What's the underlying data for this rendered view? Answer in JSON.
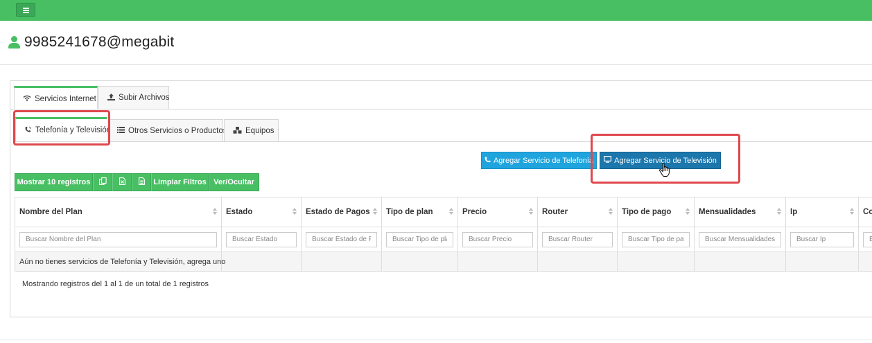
{
  "topbar": {
    "menu_icon": "hamburger-icon",
    "color": "#48bf63"
  },
  "user": {
    "icon": "user-icon",
    "name": "9985241678@megabit"
  },
  "tabs_main": [
    {
      "label": "Servicios Internet",
      "icon": "wifi-icon",
      "active": true
    },
    {
      "label": "Subir Archivos",
      "icon": "upload-icon",
      "active": false
    }
  ],
  "tabs_sub": [
    {
      "label": "Telefonía y Televisión",
      "icon": "phone-icon",
      "active": true
    },
    {
      "label": "Otros Servicios o Productos",
      "icon": "list-icon",
      "active": false
    },
    {
      "label": "Equipos",
      "icon": "cubes-icon",
      "active": false
    }
  ],
  "actions": {
    "add_phone": {
      "label": "Agregar Servicio de Telefonía",
      "icon": "phone-icon",
      "color": "#1fa4de"
    },
    "add_tv": {
      "label": "Agregar Servicio de Televisión",
      "icon": "tv-icon",
      "color": "#1c77ac"
    }
  },
  "table_buttons": {
    "show": "Mostrar 10 registros",
    "copy_icon": "copy-icon",
    "excel_icon": "excel-icon",
    "pdf_icon": "pdf-icon",
    "clear": "Limpiar Filtros",
    "toggle": "Ver/Ocultar"
  },
  "table": {
    "columns": [
      "Nombre del Plan",
      "Estado",
      "Estado de Pagos",
      "Tipo de plan",
      "Precio",
      "Router",
      "Tipo de pago",
      "Mensualidades",
      "Ip",
      "Co"
    ],
    "filters": [
      "Buscar Nombre del Plan",
      "Buscar Estado",
      "Buscar Estado de Pagos",
      "Buscar Tipo de plan",
      "Buscar Precio",
      "Buscar Router",
      "Buscar Tipo de pago",
      "Buscar Mensualidades",
      "Buscar Ip",
      "Buscar"
    ],
    "empty_message": "Aún no tienes servicios de Telefonía y Televisión, agrega uno"
  },
  "info": "Mostrando registros del 1 al 1 de un total de 1 registros",
  "highlight_color": "#e0474c"
}
